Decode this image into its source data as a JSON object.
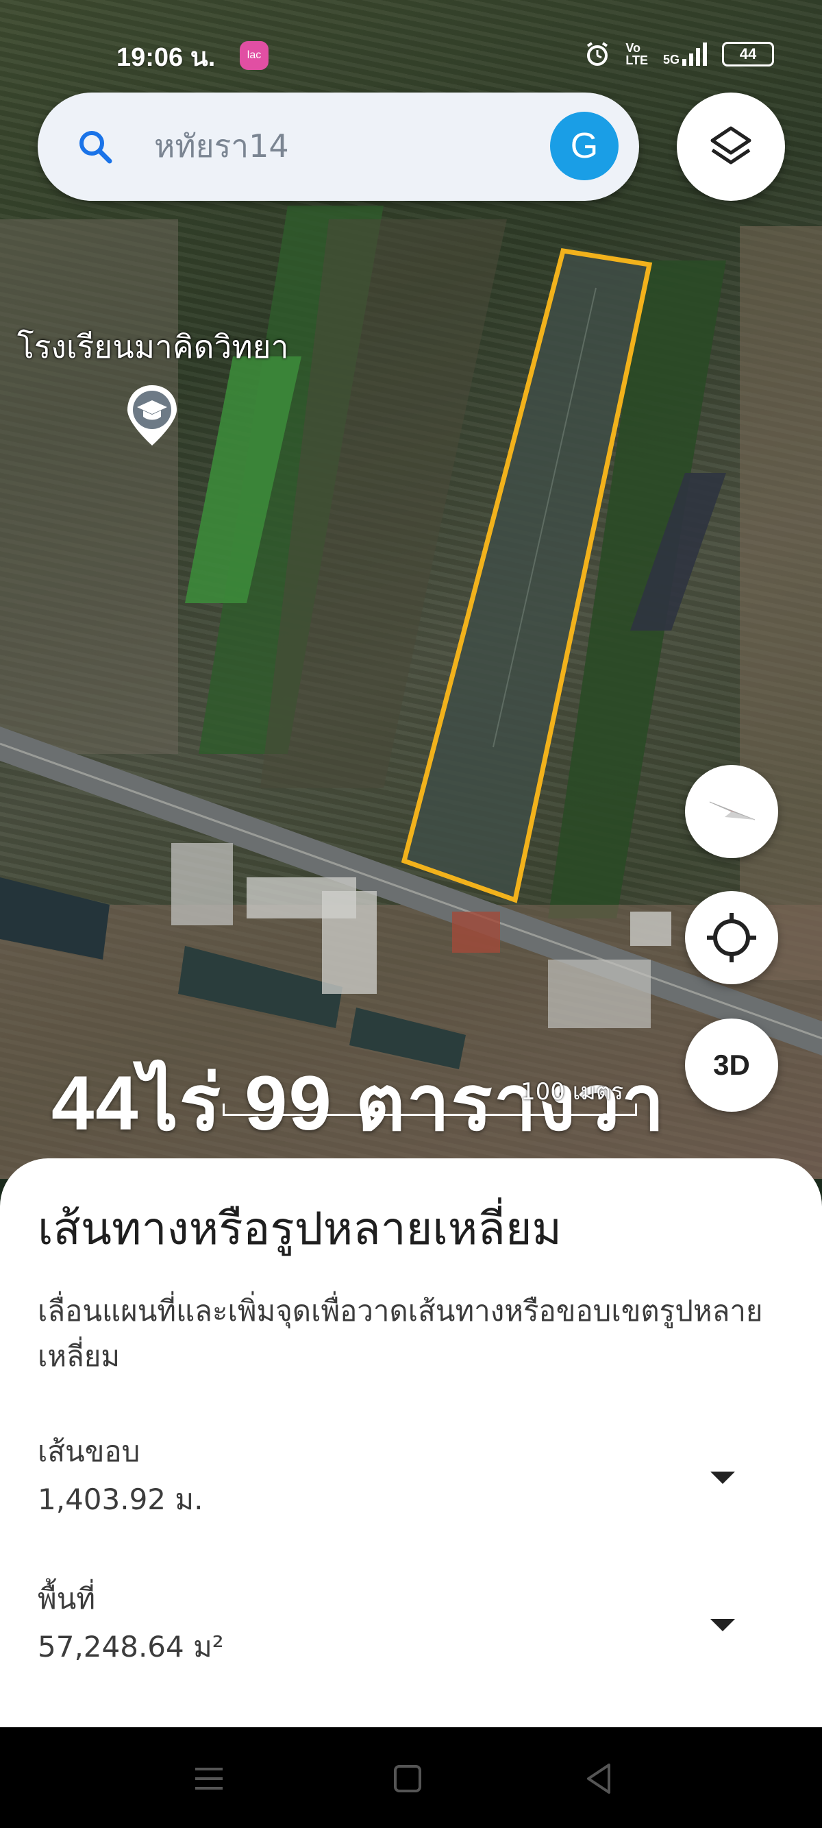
{
  "status_bar": {
    "time": "19:06 น.",
    "app_badge": "lac",
    "network_label_top": "Vo",
    "network_label_bottom": "LTE",
    "signal_label": "5G",
    "battery": "44"
  },
  "search": {
    "query": "หทัยรา14",
    "avatar_letter": "G"
  },
  "map": {
    "poi_label": "โรงเรียนมาคิดวิทยา",
    "area_overlay": "44ไร่ 99 ตารางวา",
    "scale_label": "100 เมตร",
    "polygon_color": "#f2b21c",
    "threed_label": "3D"
  },
  "sheet": {
    "title": "เส้นทางหรือรูปหลายเหลี่ยม",
    "description": "เลื่อนแผนที่และเพิ่มจุดเพื่อวาดเส้นทางหรือขอบเขตรูปหลายเหลี่ยม",
    "perimeter_label": "เส้นขอบ",
    "perimeter_value": "1,403.92 ม.",
    "area_label": "พื้นที่",
    "area_value": "57,248.64 ม²"
  }
}
